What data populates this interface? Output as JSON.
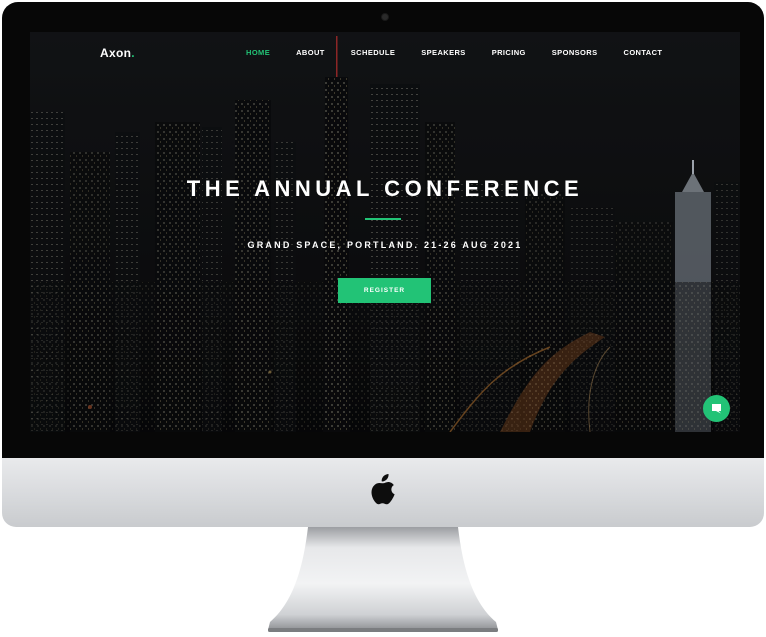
{
  "brand": {
    "name": "Axon",
    "dot": "."
  },
  "nav": {
    "items": [
      {
        "label": "HOME",
        "active": true
      },
      {
        "label": "ABOUT"
      },
      {
        "label": "SCHEDULE"
      },
      {
        "label": "SPEAKERS"
      },
      {
        "label": "PRICING"
      },
      {
        "label": "SPONSORS"
      },
      {
        "label": "CONTACT"
      }
    ]
  },
  "hero": {
    "title": "THE ANNUAL CONFERENCE",
    "subtitle": "GRAND SPACE, PORTLAND. 21-26 AUG 2021",
    "cta_label": "REGISTER"
  },
  "colors": {
    "accent": "#22c376",
    "bezel": "#070707",
    "chin": "#d6d8db"
  },
  "icons": {
    "chat": "chat-bubble-icon",
    "apple": "apple-logo-icon"
  }
}
